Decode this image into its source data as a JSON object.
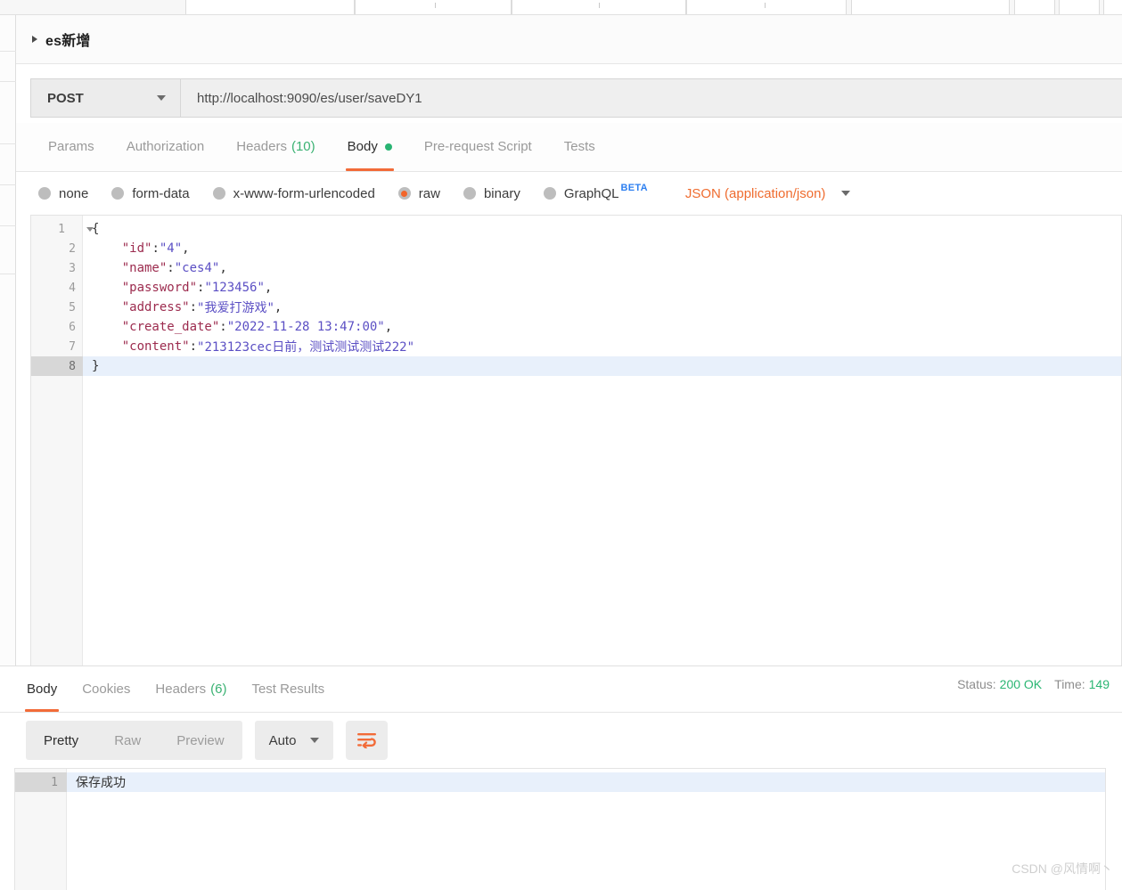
{
  "request": {
    "title": "es新增",
    "fold_icon": "triangle-right-icon",
    "method": "POST",
    "url": "http://localhost:9090/es/user/saveDY1",
    "tabs": [
      {
        "label": "Params",
        "count": "",
        "active": false,
        "dot": false
      },
      {
        "label": "Authorization",
        "count": "",
        "active": false,
        "dot": false
      },
      {
        "label": "Headers",
        "count": "(10)",
        "active": false,
        "dot": false
      },
      {
        "label": "Body",
        "count": "",
        "active": true,
        "dot": true
      },
      {
        "label": "Pre-request Script",
        "count": "",
        "active": false,
        "dot": false
      },
      {
        "label": "Tests",
        "count": "",
        "active": false,
        "dot": false
      }
    ],
    "body_types": [
      {
        "label": "none",
        "selected": false
      },
      {
        "label": "form-data",
        "selected": false
      },
      {
        "label": "x-www-form-urlencoded",
        "selected": false
      },
      {
        "label": "raw",
        "selected": true
      },
      {
        "label": "binary",
        "selected": false
      },
      {
        "label": "GraphQL",
        "selected": false,
        "badge": "BETA"
      }
    ],
    "content_type": "JSON (application/json)",
    "body_lines": [
      {
        "n": "1",
        "fold": true,
        "highlight": false,
        "parts": [
          {
            "t": "brace",
            "s": "{"
          }
        ]
      },
      {
        "n": "2",
        "fold": false,
        "highlight": false,
        "parts": [
          {
            "t": "key",
            "s": "    \"id\""
          },
          {
            "t": "punct",
            "s": ":"
          },
          {
            "t": "val",
            "s": "\"4\""
          },
          {
            "t": "punct",
            "s": ","
          }
        ]
      },
      {
        "n": "3",
        "fold": false,
        "highlight": false,
        "parts": [
          {
            "t": "key",
            "s": "    \"name\""
          },
          {
            "t": "punct",
            "s": ":"
          },
          {
            "t": "val",
            "s": "\"ces4\""
          },
          {
            "t": "punct",
            "s": ","
          }
        ]
      },
      {
        "n": "4",
        "fold": false,
        "highlight": false,
        "parts": [
          {
            "t": "key",
            "s": "    \"password\""
          },
          {
            "t": "punct",
            "s": ":"
          },
          {
            "t": "val",
            "s": "\"123456\""
          },
          {
            "t": "punct",
            "s": ","
          }
        ]
      },
      {
        "n": "5",
        "fold": false,
        "highlight": false,
        "parts": [
          {
            "t": "key",
            "s": "    \"address\""
          },
          {
            "t": "punct",
            "s": ":"
          },
          {
            "t": "val",
            "s": "\"我爱打游戏\""
          },
          {
            "t": "punct",
            "s": ","
          }
        ]
      },
      {
        "n": "6",
        "fold": false,
        "highlight": false,
        "parts": [
          {
            "t": "key",
            "s": "    \"create_date\""
          },
          {
            "t": "punct",
            "s": ":"
          },
          {
            "t": "val",
            "s": "\"2022-11-28 13:47:00\""
          },
          {
            "t": "punct",
            "s": ","
          }
        ]
      },
      {
        "n": "7",
        "fold": false,
        "highlight": false,
        "parts": [
          {
            "t": "key",
            "s": "    \"content\""
          },
          {
            "t": "punct",
            "s": ":"
          },
          {
            "t": "val",
            "s": "\"213123cec日前，测试测试测试222\""
          }
        ]
      },
      {
        "n": "8",
        "fold": false,
        "highlight": true,
        "parts": [
          {
            "t": "brace",
            "s": "}"
          }
        ]
      }
    ]
  },
  "response": {
    "tabs": [
      {
        "label": "Body",
        "count": "",
        "active": true
      },
      {
        "label": "Cookies",
        "count": "",
        "active": false
      },
      {
        "label": "Headers",
        "count": "(6)",
        "active": false
      },
      {
        "label": "Test Results",
        "count": "",
        "active": false
      }
    ],
    "status_label": "Status:",
    "status_value": "200 OK",
    "time_label": "Time:",
    "time_value": "149",
    "view_modes": [
      {
        "label": "Pretty",
        "active": true
      },
      {
        "label": "Raw",
        "active": false
      },
      {
        "label": "Preview",
        "active": false
      }
    ],
    "format": "Auto",
    "wrap_icon": "word-wrap-icon",
    "body_lines": [
      {
        "n": "1",
        "text": "保存成功",
        "highlight": true
      }
    ]
  },
  "watermark": "CSDN @风情啊丶",
  "colors": {
    "accent": "#f26b38",
    "success": "#2bb673",
    "content_type": "#ef6c2f",
    "beta": "#2d7ff0",
    "json_key": "#9c2b4e",
    "json_value": "#5b4fc4"
  }
}
